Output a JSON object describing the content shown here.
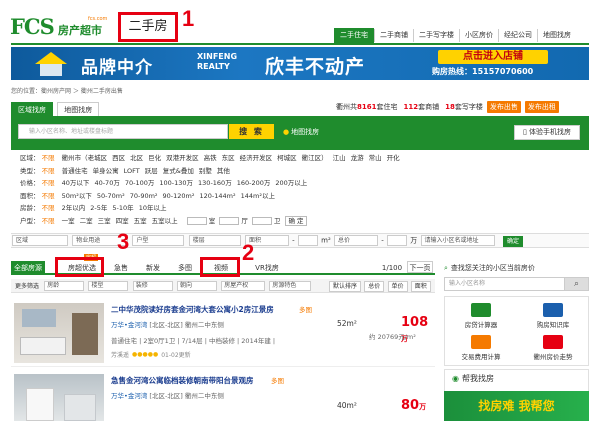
{
  "header": {
    "logo_letters": "FCS",
    "logo_text": "房产超市",
    "logo_site": "fcs.com",
    "section_title": "二手房",
    "markers": [
      "1",
      "2",
      "3"
    ],
    "topnav": [
      "二手住宅",
      "二手商铺",
      "二手写字楼",
      "小区房价",
      "经纪公司",
      "地图找房"
    ]
  },
  "banner": {
    "line1": "品牌中介",
    "brand_en_1": "XINFENG",
    "brand_en_2": "REALTY",
    "line2": "欣丰不动产",
    "cta": "点击进入店铺",
    "phone": "购房热线：15157070600"
  },
  "breadcrumb": "您的位置：衢州房产网 ＞ 衢州二手房出售",
  "search_tabs": [
    "区域找房",
    "地图找房"
  ],
  "stats": {
    "prefix": "衢州共",
    "count1": "8161",
    "label1": "套住宅",
    "count2": "112",
    "label2": "套商铺",
    "count3": "18",
    "label3": "套写字楼",
    "btn_sell": "发布出售",
    "btn_rent": "发布出租"
  },
  "search": {
    "placeholder": "输入小区名称、地址或楼盘标题",
    "button": "搜 索",
    "map_link": "地图找房",
    "experience_button": "体验手机找房"
  },
  "filters": [
    {
      "label": "区域：",
      "selected": "不限",
      "options": [
        "衢州市（老城区",
        "西区",
        "北区",
        "巨化",
        "双港开发区",
        "高铁",
        "东区",
        "经济开发区",
        "柯城区",
        "衢江区）",
        "江山",
        "龙游",
        "常山",
        "开化"
      ]
    },
    {
      "label": "类型：",
      "selected": "不限",
      "options": [
        "普通住宅",
        "单身公寓",
        "LOFT",
        "跃层",
        "复式&叠加",
        "别墅",
        "其他"
      ]
    },
    {
      "label": "价格：",
      "selected": "不限",
      "options": [
        "40万以下",
        "40-70万",
        "70-100万",
        "100-130万",
        "130-160万",
        "160-200万",
        "200万以上"
      ]
    },
    {
      "label": "面积：",
      "selected": "不限",
      "options": [
        "50m²以下",
        "50-70m²",
        "70-90m²",
        "90-120m²",
        "120-144m²",
        "144m²以上"
      ]
    },
    {
      "label": "房龄：",
      "selected": "不限",
      "options": [
        "2年以内",
        "2-5年",
        "5-10年",
        "10年以上"
      ]
    },
    {
      "label": "户型：",
      "selected": "不限",
      "options": [
        "一室",
        "二室",
        "三室",
        "四室",
        "五室",
        "五室以上"
      ],
      "extra": [
        "室",
        "厅",
        "卫",
        "确 定"
      ]
    }
  ],
  "dropbar": {
    "items": [
      "区域",
      "物业用途",
      "户型",
      "楼层",
      "面积",
      "总价"
    ],
    "area_sep": "m²",
    "price_sep": "万",
    "placeholder": "请输入小区名或地址",
    "go": "确定"
  },
  "list_tabs": {
    "all": "全部房源",
    "quality": "房超优选",
    "hot_badge": "房超",
    "urgent": "急售",
    "new": "新发",
    "multi": "多图",
    "video": "视频",
    "vr": "VR找房",
    "pager": "1/100",
    "next": "下一页"
  },
  "more_filter": {
    "label": "更多筛选",
    "items": [
      "房龄",
      "楼型",
      "装修",
      "朝向",
      "房屋产权",
      "房源特色"
    ],
    "sort": [
      "默认排序",
      "总价",
      "单价",
      "面积"
    ]
  },
  "listings": [
    {
      "title": "二中华茂院读好房套金河湾大套公寓小2房江景房",
      "tag": "多图",
      "community": "万华•金河湾",
      "district": "[北区-北区] 衢州二中东侧",
      "layout": "普通住宅 | 2室0厅1卫 | 7/14层 | 中档装修 | 2014年建 |",
      "agent": "芳溪遥",
      "date": "01-02更新",
      "area": "52m²",
      "price": "108",
      "price_unit": "万",
      "unit_price": "约 20769元/m²"
    },
    {
      "title": "急售金河湾公寓临档装修朝南带阳台景观房",
      "tag": "多图",
      "community": "万华•金河湾",
      "district": "[北区-北区] 衢州二中东侧",
      "area": "40m²",
      "price": "80",
      "price_unit": "万"
    }
  ],
  "sidebar": {
    "title": "查找您关注的小区当前房价",
    "input_placeholder": "输入小区名称",
    "tools": [
      "房贷计算器",
      "购房知识库",
      "交易费用计算",
      "衢州房价走势"
    ],
    "help_title": "帮我找房",
    "help_banner": "找房难 我帮您"
  },
  "colors": {
    "brand_green": "#1f8c2d",
    "accent_orange": "#f57a00",
    "price_red": "#e60012",
    "annotation_red": "#e60012"
  }
}
